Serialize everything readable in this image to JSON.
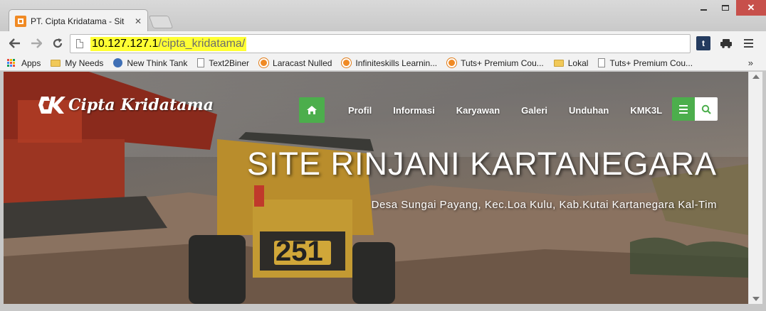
{
  "browser": {
    "tab_title": "PT. Cipta Kridatama - Site",
    "tab_close": "✕",
    "url_host": "10.127.127.1",
    "url_path": "/cipta_kridatama/",
    "window_close": "✕",
    "twitter_icon_text": "t",
    "more_bookmarks": "»"
  },
  "bookmarks": [
    {
      "label": "Apps",
      "icon": "apps-icon"
    },
    {
      "label": "My Needs",
      "icon": "folder-icon"
    },
    {
      "label": "New Think Tank",
      "icon": "globe-icon"
    },
    {
      "label": "Text2Biner",
      "icon": "page-icon"
    },
    {
      "label": "Laracast Nulled",
      "icon": "laracast-icon"
    },
    {
      "label": "Infiniteskills Learnin...",
      "icon": "laracast-icon"
    },
    {
      "label": "Tuts+ Premium Cou...",
      "icon": "laracast-icon"
    },
    {
      "label": "Lokal",
      "icon": "folder-icon"
    },
    {
      "label": "Tuts+ Premium Cou...",
      "icon": "page-icon"
    }
  ],
  "site": {
    "logo_text": "Cipta Kridatama",
    "nav": [
      "Profil",
      "Informasi",
      "Karyawan",
      "Galeri",
      "Unduhan",
      "KMK3L"
    ],
    "hero_title": "SITE RINJANI KARTANEGARA",
    "hero_subtitle": "Desa Sungai Payang, Kec.Loa Kulu, Kab.Kutai Kartanegara Kal-Tim",
    "truck_number": "251",
    "accent_color": "#4cae4c"
  }
}
